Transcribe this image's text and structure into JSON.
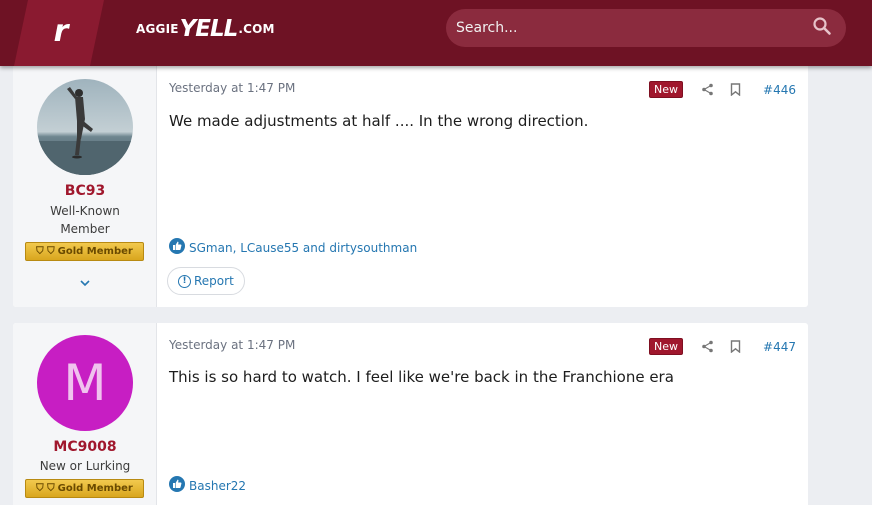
{
  "header": {
    "brand_letter": "r",
    "site_logo_left": "AGGIE",
    "site_logo_mid": "YELL",
    "site_logo_right": ".COM",
    "search_placeholder": "Search..."
  },
  "posts": [
    {
      "author": "BC93",
      "user_title": "Well-Known Member",
      "badge": "Gold Member",
      "timestamp": "Yesterday at 1:47 PM",
      "new_label": "New",
      "post_number": "#446",
      "message": "We made adjustments at half .... In the wrong direction.",
      "reactions": "SGman, LCause55 and dirtysouthman",
      "report_label": "Report"
    },
    {
      "author": "MC9008",
      "avatar_letter": "M",
      "user_title": "New or Lurking",
      "badge": "Gold Member",
      "timestamp": "Yesterday at 1:47 PM",
      "new_label": "New",
      "post_number": "#447",
      "message": "This is so hard to watch. I feel like we're back in the Franchione era",
      "reactions": "Basher22"
    }
  ],
  "colors": {
    "header_bg": "#6e1224",
    "accent": "#a0172d",
    "link": "#2577b1",
    "gold_badge": "#e6b636",
    "avatar_m_bg": "#c71ec3"
  }
}
